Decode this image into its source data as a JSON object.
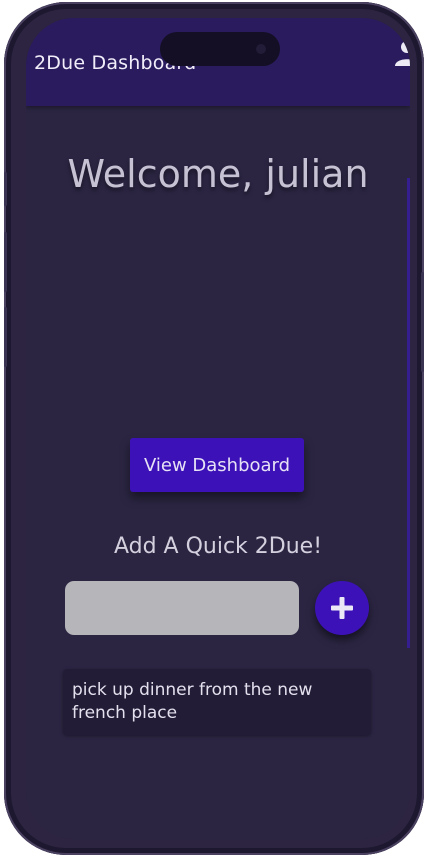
{
  "app_bar": {
    "title": "2Due Dashboard",
    "account_icon": "account-circle-icon"
  },
  "main": {
    "welcome_text": "Welcome, julian",
    "view_dashboard_label": "View Dashboard",
    "quick_add_title": "Add A Quick 2Due!",
    "quick_input_value": "",
    "add_icon": "plus-icon"
  },
  "todos": [
    {
      "text": "pick up dinner from the new french place"
    }
  ],
  "colors": {
    "app_bar": "#2a1b5e",
    "background": "#2b2542",
    "accent": "#3c12b8",
    "input": "#b6b5b9",
    "card": "#231c37"
  }
}
